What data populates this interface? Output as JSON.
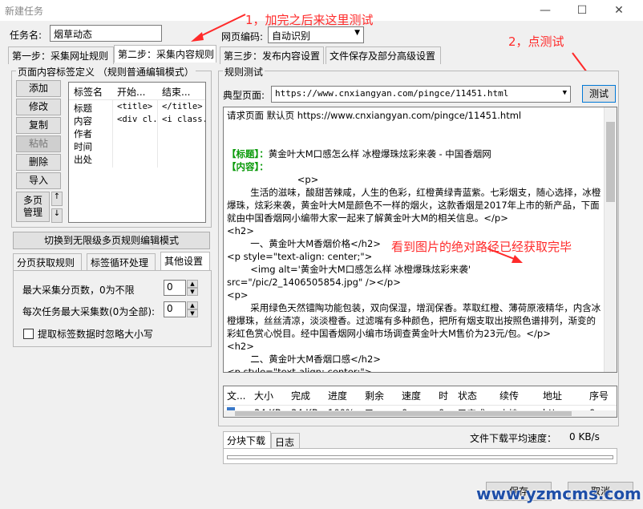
{
  "window": {
    "title": "新建任务",
    "min_icon": "minimize-icon",
    "max_icon": "maximize-icon",
    "close_icon": "close-icon"
  },
  "task": {
    "name_label": "任务名:",
    "name_value": "烟草动态",
    "encoding_label": "网页编码:",
    "encoding_value": "自动识别"
  },
  "tabs": [
    "第一步：采集网址规则",
    "第二步：采集内容规则",
    "第三步：发布内容设置",
    "文件保存及部分高级设置"
  ],
  "annotations": {
    "a1": "1，加完之后来这里测试",
    "a2": "2，点测试",
    "a3": "看到图片的绝对路径已经获取完毕"
  },
  "left": {
    "group_title": "页面内容标签定义 （规则普通编辑模式）",
    "buttons": [
      "添加",
      "修改",
      "复制",
      "粘帖",
      "删除",
      "导入"
    ],
    "multipage_label": "多页\n管理",
    "table_headers": [
      "标签名",
      "开始...",
      "结束..."
    ],
    "rows": [
      {
        "name": "标题",
        "start": "<title>",
        "end": "</title>"
      },
      {
        "name": "内容",
        "start": "<div cl...",
        "end": "<i class..."
      },
      {
        "name": "作者",
        "start": "",
        "end": ""
      },
      {
        "name": "时间",
        "start": "",
        "end": ""
      },
      {
        "name": "出处",
        "start": "",
        "end": ""
      }
    ],
    "switch_button": "切换到无限级多页规则编辑模式",
    "subtabs": [
      "分页获取规则",
      "标签循环处理",
      "其他设置"
    ],
    "max_pages_label": "最大采集分页数，0为不限",
    "max_pages_value": "0",
    "max_items_label": "每次任务最大采集数(0为全部):",
    "max_items_value": "0",
    "ignore_case_label": "提取标签数据时忽略大小写"
  },
  "right": {
    "group_title": "规则测试",
    "typical_label": "典型页面:",
    "typical_url": "https://www.cnxiangyan.com/pingce/11451.html",
    "test_button": "测试",
    "output": [
      {
        "t": "请求页面 默认页 https://www.cnxiangyan.com/pingce/11451.html",
        "c": ""
      },
      {
        "t": "",
        "c": ""
      },
      {
        "t": "",
        "c": ""
      },
      {
        "t": "【标题】：",
        "c": "g",
        "rest": "黄金叶大M口感怎么样 冰橙爆珠炫彩来袭 - 中国香烟网"
      },
      {
        "t": "【内容】：",
        "c": "g",
        "rest": ""
      },
      {
        "t": "                        <p>",
        "c": ""
      },
      {
        "t": "        生活的滋味，酸甜苦辣咸，人生的色彩，红橙黄绿青蓝紫。七彩烟支，随心选择，冰橙爆珠，炫彩来袭，黄金叶大M是颜色不一样的烟火，这款香烟是2017年上市的新产品，下面就由中国香烟网小编带大家一起来了解黄金叶大M的相关信息。</p>",
        "c": ""
      },
      {
        "t": "<h2>",
        "c": ""
      },
      {
        "t": "        一、黄金叶大M香烟价格</h2>",
        "c": ""
      },
      {
        "t": "<p style=\"text-align: center;\">",
        "c": ""
      },
      {
        "t": "        <img alt='黄金叶大M口感怎么样 冰橙爆珠炫彩来袭' src=\"/pic/2_1406505854.jpg\" /></p>",
        "c": ""
      },
      {
        "t": "<p>",
        "c": ""
      },
      {
        "t": "        采用绿色天然镭陶功能包装，双向保湿，增润保香。萃取红橙、薄荷原液精华，内含冰橙爆珠，丝丝清凉，淡淡橙香。过滤嘴有多种颜色，把所有烟支取出按照色谱排列，渐变的彩虹色赏心悦目。经中国香烟网小编市场调查黄金叶大M售价为23元/包。</p>",
        "c": ""
      },
      {
        "t": "<h2>",
        "c": ""
      },
      {
        "t": "        二、黄金叶大M香烟口感</h2>",
        "c": ""
      },
      {
        "t": "<p style=\"text-align: center;\">",
        "c": ""
      }
    ],
    "dl_headers": [
      "文...",
      "大小",
      "完成",
      "进度",
      "剩余",
      "速度",
      "时",
      "状态",
      "续传",
      "地址",
      "序号"
    ],
    "dl_row": [
      "",
      "34 KB",
      "34 KB",
      "100%",
      "已",
      "0",
      "0",
      "已完成",
      "支持",
      "http",
      "0"
    ],
    "bottom_tabs": [
      "分块下载",
      "日志"
    ],
    "speed_label": "文件下载平均速度：",
    "speed_value": "0 KB/s"
  },
  "footer": {
    "save": "保存",
    "cancel": "取消",
    "watermark": "www.yzmcms.com"
  }
}
